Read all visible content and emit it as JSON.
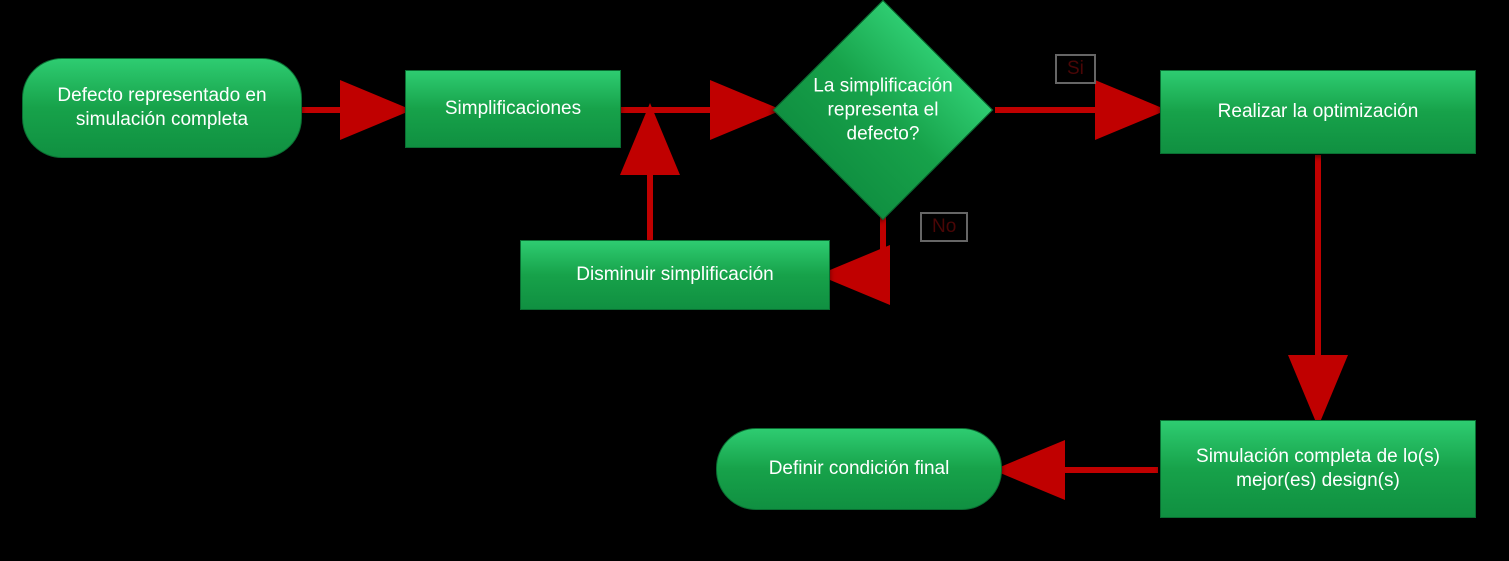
{
  "nodes": {
    "start": "Defecto representado en simulación completa",
    "simplify": "Simplificaciones",
    "decision": "La simplificación representa el defecto?",
    "decrease": "Disminuir simplificación",
    "optimize": "Realizar la optimización",
    "fullsim": "Simulación completa de lo(s) mejor(es) design(s)",
    "final": "Definir condición final"
  },
  "labels": {
    "yes": "Si",
    "no": "No"
  },
  "colors": {
    "arrow": "#c00000",
    "node_fill": "#17a24a",
    "label_border": "#666666",
    "label_text": "#4a0606"
  }
}
